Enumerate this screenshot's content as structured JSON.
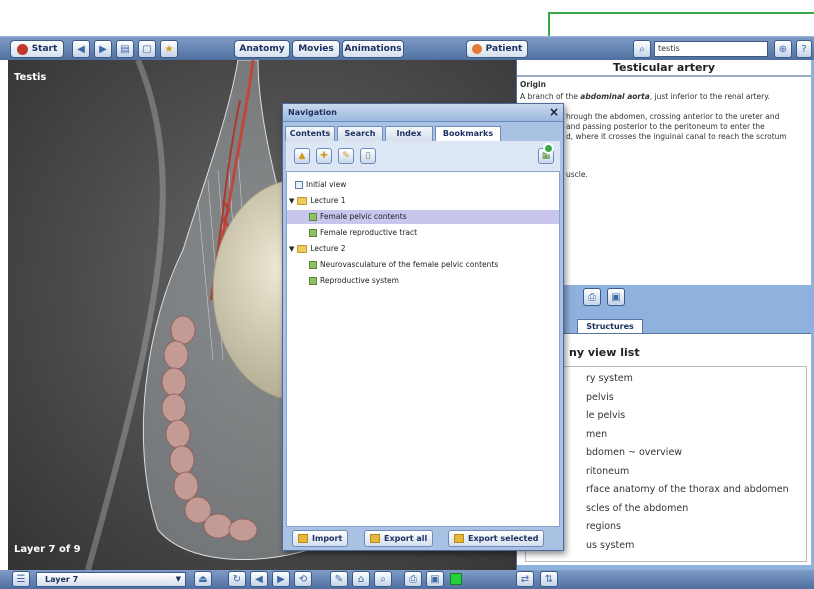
{
  "toolbar": {
    "start_label": "Start",
    "tabs": [
      "Anatomy",
      "Movies",
      "Animations"
    ],
    "patient_label": "Patient",
    "search_value": "testis"
  },
  "viewport": {
    "title": "Testis",
    "layer_status": "Layer 7 of 9"
  },
  "info_panel": {
    "title": "Testicular artery",
    "origin_heading": "Origin",
    "origin_prefix": "A branch of the ",
    "origin_bold": "abdominal aorta",
    "origin_suffix": ", just inferior to the renal artery.",
    "course_line1": "hrough the abdomen, crossing anterior to the ureter and",
    "course_line2": "and passing posterior to the peritoneum to enter the",
    "course_line3": "d, where it crosses the inguinal canal to reach the scrotum",
    "muscle_fragment": "uscle."
  },
  "structures_tab": "Structures",
  "my_view_list": {
    "title": "ny view list",
    "items": [
      "ry system",
      "pelvis",
      "le pelvis",
      "men",
      "bdomen ~ overview",
      "ritoneum",
      "rface anatomy of the thorax and abdomen",
      "scles of the abdomen",
      "regions",
      "us system"
    ]
  },
  "navigation": {
    "title": "Navigation",
    "tabs": [
      "Contents",
      "Search",
      "Index",
      "Bookmarks"
    ],
    "active_tab": "Bookmarks",
    "tree": {
      "initial_view": "Initial view",
      "lecture1": "Lecture 1",
      "l1_item1": "Female pelvic contents",
      "l1_item2": "Female reproductive tract",
      "lecture2": "Lecture 2",
      "l2_item1": "Neurovasculature of the female pelvic contents",
      "l2_item2": "Reproductive system"
    },
    "footer": {
      "import": "Import",
      "export_all": "Export all",
      "export_selected": "Export selected"
    }
  },
  "bottom": {
    "layer_select": "Layer 7"
  },
  "colors": {
    "accent_blue": "#4f6fa0",
    "callout_green": "#37a84a",
    "selection": "#c9c6ee"
  }
}
